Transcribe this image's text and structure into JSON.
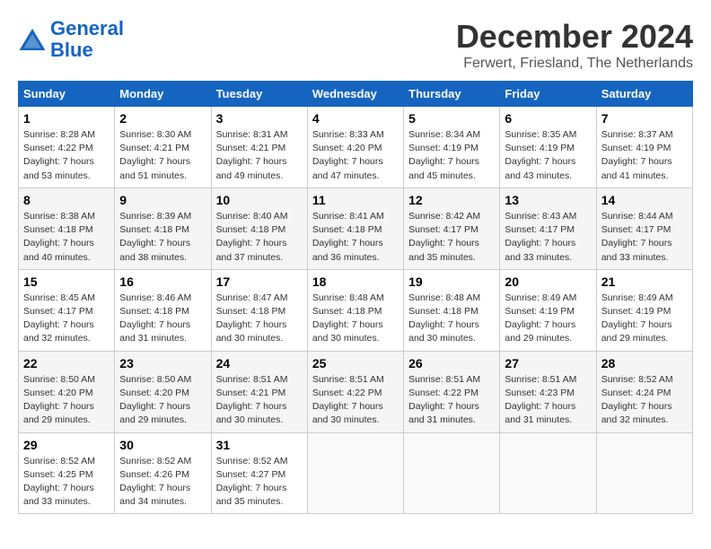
{
  "header": {
    "logo_line1": "General",
    "logo_line2": "Blue",
    "month": "December 2024",
    "location": "Ferwert, Friesland, The Netherlands"
  },
  "days_of_week": [
    "Sunday",
    "Monday",
    "Tuesday",
    "Wednesday",
    "Thursday",
    "Friday",
    "Saturday"
  ],
  "weeks": [
    [
      {
        "day": "1",
        "sunrise": "8:28 AM",
        "sunset": "4:22 PM",
        "daylight_hours": "7",
        "daylight_mins": "53"
      },
      {
        "day": "2",
        "sunrise": "8:30 AM",
        "sunset": "4:21 PM",
        "daylight_hours": "7",
        "daylight_mins": "51"
      },
      {
        "day": "3",
        "sunrise": "8:31 AM",
        "sunset": "4:21 PM",
        "daylight_hours": "7",
        "daylight_mins": "49"
      },
      {
        "day": "4",
        "sunrise": "8:33 AM",
        "sunset": "4:20 PM",
        "daylight_hours": "7",
        "daylight_mins": "47"
      },
      {
        "day": "5",
        "sunrise": "8:34 AM",
        "sunset": "4:19 PM",
        "daylight_hours": "7",
        "daylight_mins": "45"
      },
      {
        "day": "6",
        "sunrise": "8:35 AM",
        "sunset": "4:19 PM",
        "daylight_hours": "7",
        "daylight_mins": "43"
      },
      {
        "day": "7",
        "sunrise": "8:37 AM",
        "sunset": "4:19 PM",
        "daylight_hours": "7",
        "daylight_mins": "41"
      }
    ],
    [
      {
        "day": "8",
        "sunrise": "8:38 AM",
        "sunset": "4:18 PM",
        "daylight_hours": "7",
        "daylight_mins": "40"
      },
      {
        "day": "9",
        "sunrise": "8:39 AM",
        "sunset": "4:18 PM",
        "daylight_hours": "7",
        "daylight_mins": "38"
      },
      {
        "day": "10",
        "sunrise": "8:40 AM",
        "sunset": "4:18 PM",
        "daylight_hours": "7",
        "daylight_mins": "37"
      },
      {
        "day": "11",
        "sunrise": "8:41 AM",
        "sunset": "4:18 PM",
        "daylight_hours": "7",
        "daylight_mins": "36"
      },
      {
        "day": "12",
        "sunrise": "8:42 AM",
        "sunset": "4:17 PM",
        "daylight_hours": "7",
        "daylight_mins": "35"
      },
      {
        "day": "13",
        "sunrise": "8:43 AM",
        "sunset": "4:17 PM",
        "daylight_hours": "7",
        "daylight_mins": "33"
      },
      {
        "day": "14",
        "sunrise": "8:44 AM",
        "sunset": "4:17 PM",
        "daylight_hours": "7",
        "daylight_mins": "33"
      }
    ],
    [
      {
        "day": "15",
        "sunrise": "8:45 AM",
        "sunset": "4:17 PM",
        "daylight_hours": "7",
        "daylight_mins": "32"
      },
      {
        "day": "16",
        "sunrise": "8:46 AM",
        "sunset": "4:18 PM",
        "daylight_hours": "7",
        "daylight_mins": "31"
      },
      {
        "day": "17",
        "sunrise": "8:47 AM",
        "sunset": "4:18 PM",
        "daylight_hours": "7",
        "daylight_mins": "30"
      },
      {
        "day": "18",
        "sunrise": "8:48 AM",
        "sunset": "4:18 PM",
        "daylight_hours": "7",
        "daylight_mins": "30"
      },
      {
        "day": "19",
        "sunrise": "8:48 AM",
        "sunset": "4:18 PM",
        "daylight_hours": "7",
        "daylight_mins": "30"
      },
      {
        "day": "20",
        "sunrise": "8:49 AM",
        "sunset": "4:19 PM",
        "daylight_hours": "7",
        "daylight_mins": "29"
      },
      {
        "day": "21",
        "sunrise": "8:49 AM",
        "sunset": "4:19 PM",
        "daylight_hours": "7",
        "daylight_mins": "29"
      }
    ],
    [
      {
        "day": "22",
        "sunrise": "8:50 AM",
        "sunset": "4:20 PM",
        "daylight_hours": "7",
        "daylight_mins": "29"
      },
      {
        "day": "23",
        "sunrise": "8:50 AM",
        "sunset": "4:20 PM",
        "daylight_hours": "7",
        "daylight_mins": "29"
      },
      {
        "day": "24",
        "sunrise": "8:51 AM",
        "sunset": "4:21 PM",
        "daylight_hours": "7",
        "daylight_mins": "30"
      },
      {
        "day": "25",
        "sunrise": "8:51 AM",
        "sunset": "4:22 PM",
        "daylight_hours": "7",
        "daylight_mins": "30"
      },
      {
        "day": "26",
        "sunrise": "8:51 AM",
        "sunset": "4:22 PM",
        "daylight_hours": "7",
        "daylight_mins": "31"
      },
      {
        "day": "27",
        "sunrise": "8:51 AM",
        "sunset": "4:23 PM",
        "daylight_hours": "7",
        "daylight_mins": "31"
      },
      {
        "day": "28",
        "sunrise": "8:52 AM",
        "sunset": "4:24 PM",
        "daylight_hours": "7",
        "daylight_mins": "32"
      }
    ],
    [
      {
        "day": "29",
        "sunrise": "8:52 AM",
        "sunset": "4:25 PM",
        "daylight_hours": "7",
        "daylight_mins": "33"
      },
      {
        "day": "30",
        "sunrise": "8:52 AM",
        "sunset": "4:26 PM",
        "daylight_hours": "7",
        "daylight_mins": "34"
      },
      {
        "day": "31",
        "sunrise": "8:52 AM",
        "sunset": "4:27 PM",
        "daylight_hours": "7",
        "daylight_mins": "35"
      },
      null,
      null,
      null,
      null
    ]
  ]
}
